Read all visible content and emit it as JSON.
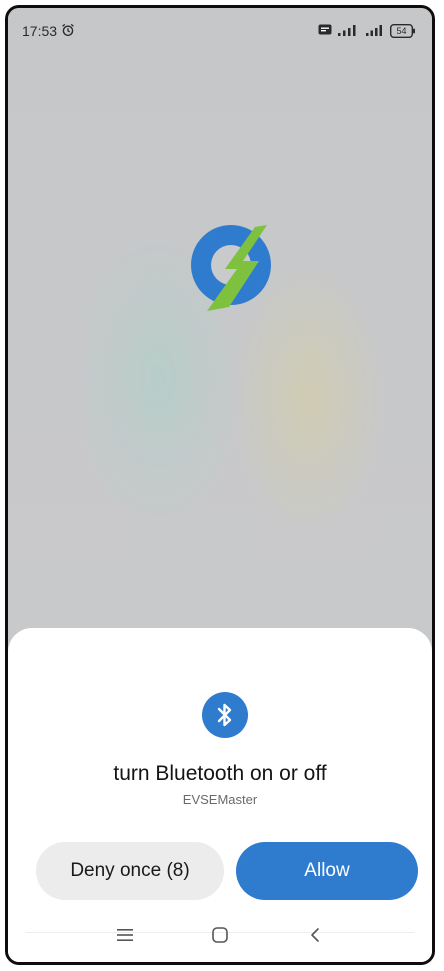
{
  "status_bar": {
    "time": "17:53",
    "battery_level": "54",
    "icons": [
      "alarm-icon",
      "message-icon",
      "signal-icon",
      "signal-icon",
      "battery-icon"
    ]
  },
  "app_logo": {
    "icon": "evse-logo-icon"
  },
  "permission_dialog": {
    "icon": "bluetooth-icon",
    "title": "turn Bluetooth on or off",
    "app_name": "EVSEMaster",
    "deny_label": "Deny once (8)",
    "allow_label": "Allow"
  },
  "nav_bar": {
    "items": [
      "menu-icon",
      "home-icon",
      "back-icon"
    ]
  },
  "colors": {
    "accent": "#2f7ccf",
    "deny_bg": "#ececec",
    "wallpaper": "#c7c8ca",
    "logo_green": "#7dc13f"
  }
}
